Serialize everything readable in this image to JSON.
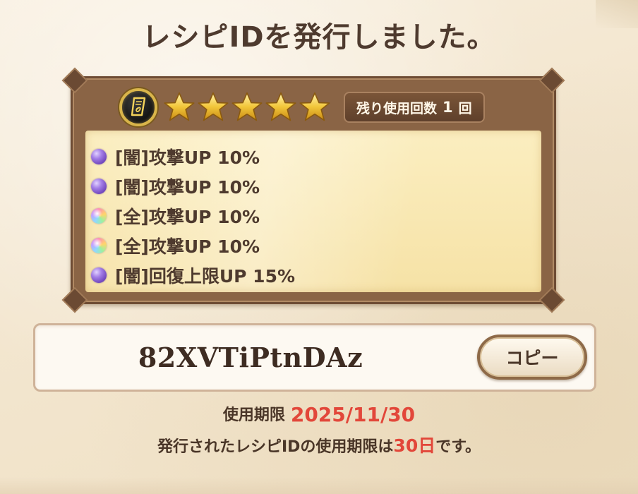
{
  "title": "レシピIDを発行しました。",
  "recipe_card": {
    "icon": "ring-scroll-icon",
    "rarity_stars": 5,
    "remaining_uses_label": "残り使用回数",
    "remaining_uses_value": "1",
    "remaining_uses_unit": "回",
    "effects": [
      {
        "orb": "dark-orb-icon",
        "text": "[闇]攻撃UP 10%"
      },
      {
        "orb": "dark-orb-icon",
        "text": "[闇]攻撃UP 10%"
      },
      {
        "orb": "rainbow-orb-icon",
        "text": "[全]攻撃UP 10%"
      },
      {
        "orb": "rainbow-orb-icon",
        "text": "[全]攻撃UP 10%"
      },
      {
        "orb": "dark-orb-icon",
        "text": "[闇]回復上限UP 15%"
      }
    ]
  },
  "recipe_code": {
    "value": "82XVTiPtnDAz",
    "copy_label": "コピー"
  },
  "expiry": {
    "label": "使用期限",
    "date": "2025/11/30"
  },
  "note": {
    "prefix": "発行されたレシピIDの使用期限は",
    "days": "30日",
    "suffix": "です。"
  },
  "colors": {
    "accent_red": "#e2473a",
    "text_brown": "#4a3628",
    "star_gold": "#f2c63a"
  }
}
